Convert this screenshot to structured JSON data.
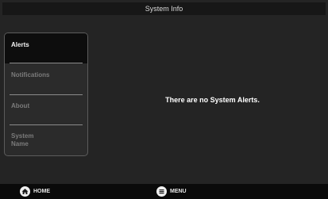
{
  "window": {
    "title": "System Info"
  },
  "sidebar": {
    "items": [
      {
        "label": "Alerts",
        "active": true
      },
      {
        "label": "Notifications",
        "active": false
      },
      {
        "label": "About",
        "active": false
      },
      {
        "label": "System Name",
        "active": false
      }
    ]
  },
  "main": {
    "message": "There are no System Alerts."
  },
  "bottom_nav": {
    "home_label": "HOME",
    "home_icon": "home-icon",
    "menu_label": "MENU",
    "menu_icon": "menu-icon"
  },
  "colors": {
    "background": "#242424",
    "title_bar": "#171717",
    "active_item": "#0d0d0d",
    "inactive_text": "#7b7b7b",
    "active_text": "#f2f2f2"
  }
}
